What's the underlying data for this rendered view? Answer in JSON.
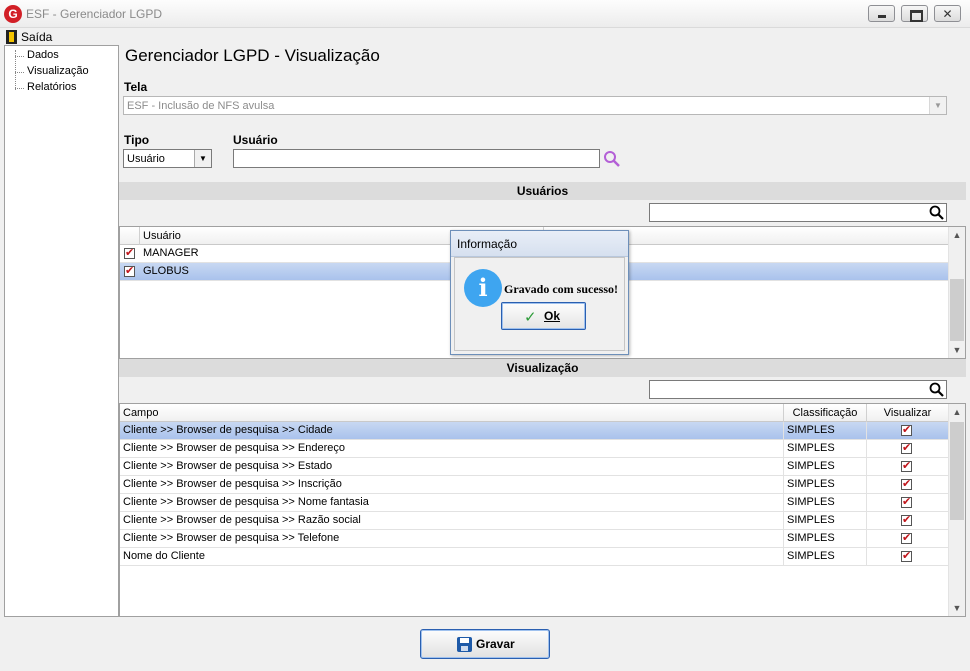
{
  "window": {
    "title": "ESF - Gerenciador LGPD",
    "logo": "G"
  },
  "menu": {
    "exit_label": "Saída"
  },
  "tree": {
    "items": [
      "Dados",
      "Visualização",
      "Relatórios"
    ]
  },
  "page": {
    "title": "Gerenciador LGPD - Visualização"
  },
  "form": {
    "tela_label": "Tela",
    "tela_value": "ESF - Inclusão de NFS avulsa",
    "tipo_label": "Tipo",
    "tipo_value": "Usuário",
    "usuario_label": "Usuário",
    "usuario_value": ""
  },
  "usuarios_section": {
    "title": "Usuários",
    "filter_value": "",
    "columns": [
      "Usuário"
    ],
    "rows": [
      {
        "checked": true,
        "user": "MANAGER",
        "selected": false
      },
      {
        "checked": true,
        "user": "GLOBUS",
        "selected": true
      }
    ]
  },
  "visualizacao_section": {
    "title": "Visualização",
    "filter_value": "",
    "columns": [
      "Campo",
      "Classificação",
      "Visualizar"
    ],
    "rows": [
      {
        "campo": "Cliente >> Browser de pesquisa >> Cidade",
        "classificacao": "SIMPLES",
        "visualizar": true,
        "selected": true
      },
      {
        "campo": "Cliente >> Browser de pesquisa >> Endereço",
        "classificacao": "SIMPLES",
        "visualizar": true,
        "selected": false
      },
      {
        "campo": "Cliente >> Browser de pesquisa >> Estado",
        "classificacao": "SIMPLES",
        "visualizar": true,
        "selected": false
      },
      {
        "campo": "Cliente >> Browser de pesquisa >> Inscrição",
        "classificacao": "SIMPLES",
        "visualizar": true,
        "selected": false
      },
      {
        "campo": "Cliente >> Browser de pesquisa >> Nome fantasia",
        "classificacao": "SIMPLES",
        "visualizar": true,
        "selected": false
      },
      {
        "campo": "Cliente >> Browser de pesquisa >> Razão social",
        "classificacao": "SIMPLES",
        "visualizar": true,
        "selected": false
      },
      {
        "campo": "Cliente >> Browser de pesquisa >> Telefone",
        "classificacao": "SIMPLES",
        "visualizar": true,
        "selected": false
      },
      {
        "campo": "Nome do Cliente",
        "classificacao": "SIMPLES",
        "visualizar": true,
        "selected": false
      }
    ]
  },
  "dialog": {
    "title": "Informação",
    "message": "Gravado com sucesso!",
    "ok_label": "Ok",
    "icon": "info-icon"
  },
  "actions": {
    "save_label": "Gravar"
  },
  "colors": {
    "selection": "#a9c2ec",
    "check": "#c0141a",
    "info": "#3ea5f0",
    "accent_border": "#2a5fb0"
  }
}
